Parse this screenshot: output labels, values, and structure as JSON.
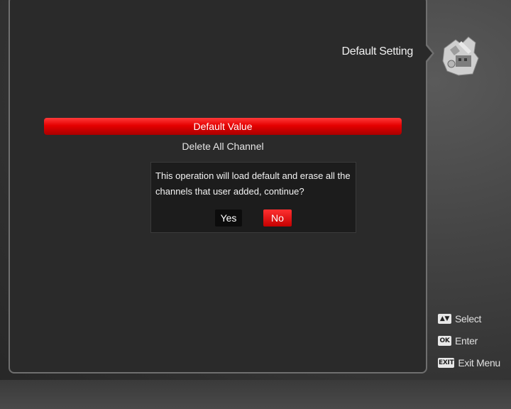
{
  "header": {
    "title": "Default Setting",
    "icon": "settings-tools-icon"
  },
  "menu": {
    "items": [
      {
        "label": "Default Value"
      },
      {
        "label": "Delete All Channel"
      }
    ]
  },
  "dialog": {
    "message": "This operation will load default and erase all the channels that user added, continue?",
    "yes_label": "Yes",
    "no_label": "No"
  },
  "legend": [
    {
      "key": "▲▼",
      "label": "Select",
      "icon": "updown-key-icon"
    },
    {
      "key": "OK",
      "label": "Enter",
      "icon": "ok-key-icon"
    },
    {
      "key": "EXIT",
      "label": "Exit Menu",
      "icon": "exit-key-icon"
    }
  ],
  "colors": {
    "accent": "#e50000",
    "panel": "#2a2a2a",
    "dialog": "#1c1c1c"
  }
}
